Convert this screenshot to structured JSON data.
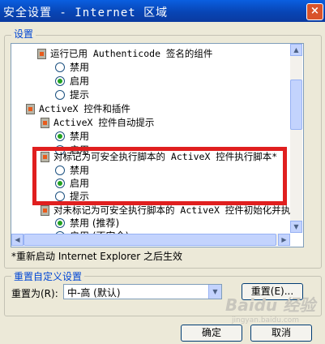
{
  "window": {
    "title": "安全设置 - Internet 区域",
    "close_label": "×"
  },
  "settings_group": {
    "label": "设置"
  },
  "list": {
    "rows": [
      {
        "kind": "item",
        "label": "运行已用 Authenticode 签名的组件"
      },
      {
        "kind": "option",
        "label": "禁用",
        "selected": false
      },
      {
        "kind": "option",
        "label": "启用",
        "selected": true
      },
      {
        "kind": "option",
        "label": "提示",
        "selected": false
      },
      {
        "kind": "category",
        "label": "ActiveX 控件和插件"
      },
      {
        "kind": "item",
        "label": "ActiveX 控件自动提示"
      },
      {
        "kind": "option",
        "label": "禁用",
        "selected": true
      },
      {
        "kind": "option",
        "label": "启用",
        "selected": false
      },
      {
        "kind": "item",
        "label": "对标记为可安全执行脚本的 ActiveX 控件执行脚本*"
      },
      {
        "kind": "option",
        "label": "禁用",
        "selected": false
      },
      {
        "kind": "option",
        "label": "启用",
        "selected": true
      },
      {
        "kind": "option",
        "label": "提示",
        "selected": false
      },
      {
        "kind": "item",
        "label": "对未标记为可安全执行脚本的 ActiveX 控件初始化并执"
      },
      {
        "kind": "option",
        "label": "禁用 (推荐)",
        "selected": true
      },
      {
        "kind": "option",
        "label": "启用 (不安全)",
        "selected": false
      }
    ]
  },
  "note": "*重新启动 Internet Explorer 之后生效",
  "reset_group": {
    "label": "重置自定义设置",
    "reset_to_label": "重置为(R):",
    "combo_value": "中-高 (默认)",
    "reset_button": "重置(E)..."
  },
  "buttons": {
    "ok": "确定",
    "cancel": "取消"
  },
  "watermark": {
    "brand": "Baidu 经验",
    "url": "jingyan.baidu.com"
  },
  "colors": {
    "highlight_border": "#e01f1f",
    "group_label": "#0046d5"
  }
}
